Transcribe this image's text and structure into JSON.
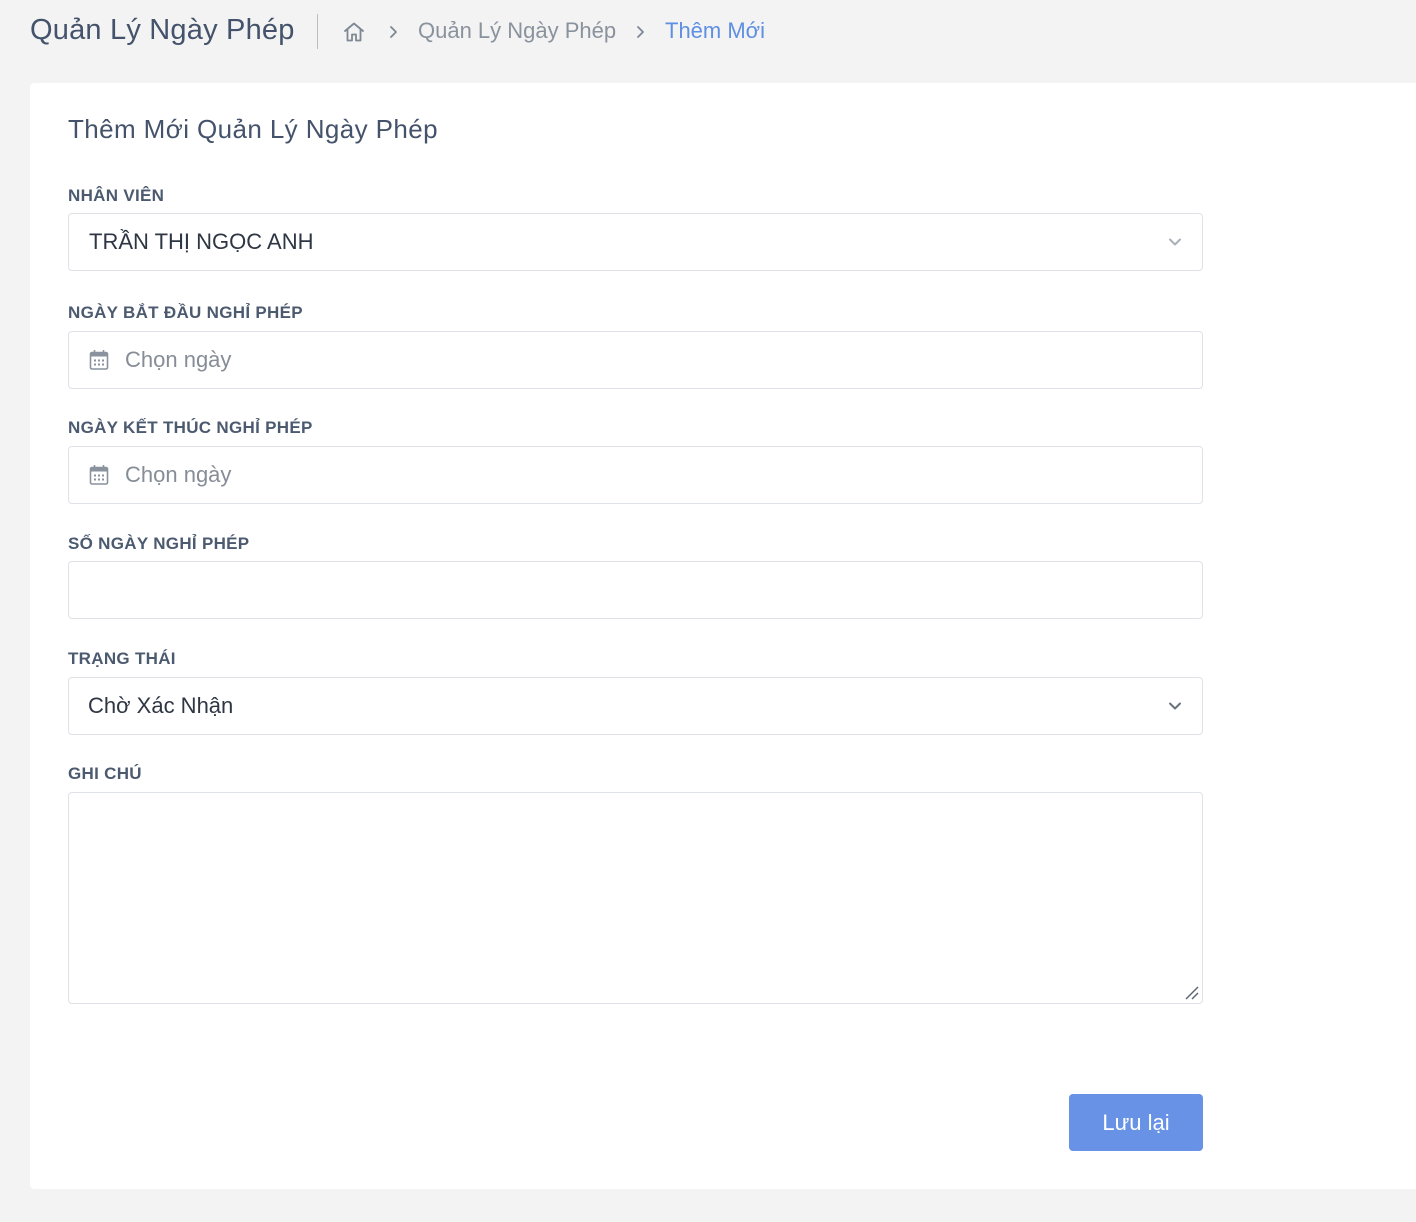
{
  "header": {
    "title": "Quản Lý Ngày Phép",
    "breadcrumb": {
      "home_icon": "home-icon",
      "items": [
        "Quản Lý Ngày Phép",
        "Thêm Mới"
      ]
    }
  },
  "form": {
    "title": "Thêm Mới Quản Lý Ngày Phép",
    "employee": {
      "label": "NHÂN VIÊN",
      "value": "TRẦN THỊ NGỌC ANH"
    },
    "start_date": {
      "label": "NGÀY BẮT ĐẦU NGHỈ PHÉP",
      "placeholder": "Chọn ngày",
      "icon": "calendar-icon"
    },
    "end_date": {
      "label": "NGÀY KẾT THÚC NGHỈ PHÉP",
      "placeholder": "Chọn ngày",
      "icon": "calendar-icon"
    },
    "days": {
      "label": "SỐ NGÀY NGHỈ PHÉP",
      "value": ""
    },
    "status": {
      "label": "TRẠNG THÁI",
      "value": "Chờ Xác Nhận"
    },
    "note": {
      "label": "GHI CHÚ",
      "value": ""
    },
    "save_label": "Lưu lại"
  },
  "colors": {
    "accent": "#6892e5",
    "breadcrumb_active": "#5f8fe3",
    "background": "#f2f3f2"
  }
}
